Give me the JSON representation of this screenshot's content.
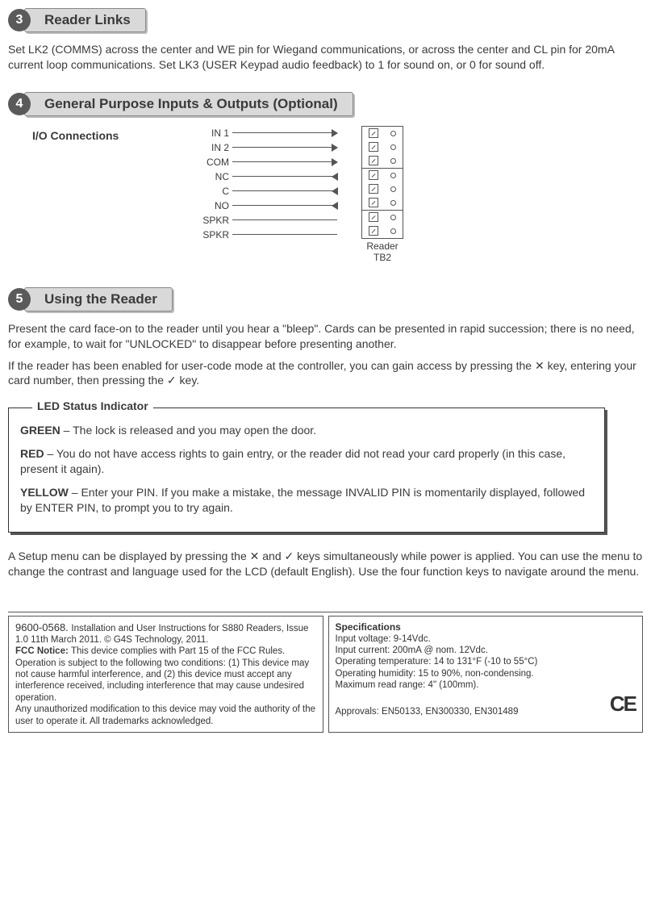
{
  "section3": {
    "num": "3",
    "title": "Reader Links",
    "body": "Set LK2 (COMMS) across the center and WE pin for Wiegand communications, or across the center and CL pin for 20mA current loop communications. Set LK3 (USER Keypad audio feedback) to 1 for sound on, or 0 for sound off."
  },
  "section4": {
    "num": "4",
    "title": "General Purpose Inputs & Outputs (Optional)",
    "io_label": "I/O Connections",
    "pins": [
      "IN 1",
      "IN 2",
      "COM",
      "NC",
      "C",
      "NO",
      "SPKR",
      "SPKR"
    ],
    "tb_caption_1": "Reader",
    "tb_caption_2": "TB2"
  },
  "section5": {
    "num": "5",
    "title": "Using the Reader",
    "para1": "Present the card face-on to the reader until you hear a \"bleep\". Cards can be presented in rapid succession; there is no need, for example, to wait for \"UNLOCKED\" to disappear before presenting another.",
    "para2_a": "If the reader has been enabled for user-code mode at the controller, you can gain access by pressing the ",
    "cross": "✕",
    "para2_b": " key, entering your card number, then pressing the ",
    "check": "✓",
    "para2_c": " key.",
    "led_title": "LED Status Indicator",
    "green_label": "GREEN",
    "green_text": " – The lock is released and you may open the door.",
    "red_label": "RED",
    "red_text": " – You do not have access rights to gain entry, or the reader did not read your card properly (in this case, present it again).",
    "yellow_label": "YELLOW",
    "yellow_text": " – Enter your PIN. If you make a mistake, the message INVALID PIN is momentarily displayed, followed by ENTER PIN, to prompt you to try again.",
    "setup_a": "A Setup menu can be displayed by pressing the ",
    "setup_b": " and ",
    "setup_c": " keys simultaneously while power is applied. You can use the menu to change the contrast and language used for the LCD (default English). Use the four function keys to navigate around the menu."
  },
  "footer": {
    "left": {
      "doc": "9600-0568. ",
      "doc_rest": "Installation and User Instructions for S880 Readers, Issue 1.0 11th March 2011. © G4S Technology, 2011.",
      "fcc_label": "FCC Notice: ",
      "fcc_text": "This device complies with Part 15 of the FCC Rules. Operation is subject to the following two conditions: (1) This device may not cause harmful interference, and (2) this device must accept any interference received, including interference that may cause undesired operation.",
      "mod": "Any unauthorized modification to this device may void the authority of the user to operate it. All trademarks acknowledged."
    },
    "right": {
      "hdr": "Specifications",
      "l1": "Input voltage: 9-14Vdc.",
      "l2": "Input current:  200mA @ nom. 12Vdc.",
      "l3": "Operating temperature: 14 to 131°F (-10 to 55°C)",
      "l4": "Operating humidity: 15 to 90%, non-condensing.",
      "l5": "Maximum read range: 4\" (100mm).",
      "l6": "Approvals: EN50133, EN300330, EN301489",
      "ce": "CE"
    }
  }
}
